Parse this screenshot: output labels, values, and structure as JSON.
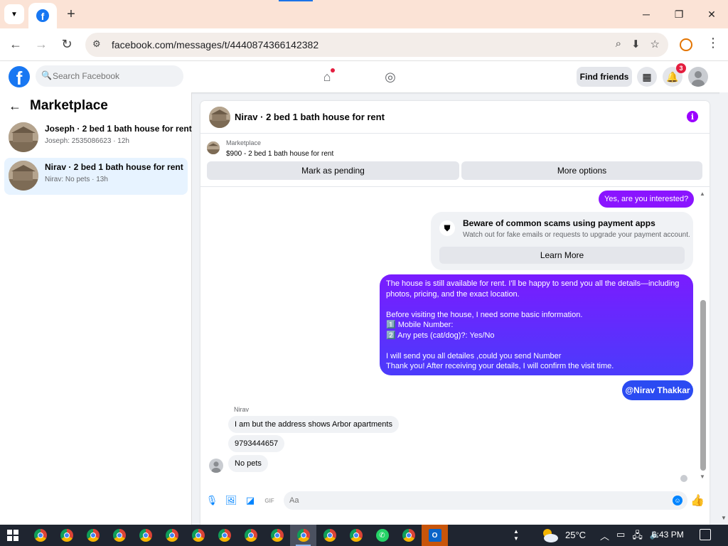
{
  "browser": {
    "url": "facebook.com/messages/t/4440874366142382"
  },
  "fb_header": {
    "search_placeholder": "Search Facebook",
    "find_friends_label": "Find friends",
    "notification_count": "3"
  },
  "sidebar": {
    "title": "Marketplace",
    "conversations": [
      {
        "title": "Joseph · 2 bed 1 bath house for rent",
        "snippet": "Joseph: 2535086623 · 12h",
        "active": false
      },
      {
        "title": "Nirav · 2 bed 1 bath house for rent",
        "snippet": "Nirav: No pets · 13h",
        "active": true
      }
    ]
  },
  "chat": {
    "title": "Nirav · 2 bed 1 bath house for rent",
    "listing": {
      "source": "Marketplace",
      "title": "$900 - 2 bed 1 bath house for rent",
      "mark_pending_label": "Mark as pending",
      "more_options_label": "More options"
    },
    "messages": {
      "outgoing_interested": "Yes, are you interested?",
      "scam_title": "Beware of common scams using payment apps",
      "scam_subtitle": "Watch out for fake emails or requests to upgrade your payment account.",
      "learn_more_label": "Learn More",
      "long_message": "The house is still available for rent. I'll be happy to send you all the details—including photos, pricing, and the exact location.\n\nBefore visiting the house, I need some basic information.\n1️⃣  Mobile Number:\n2️⃣ Any pets (cat/dog)?: Yes/No\n\nI will send you all detailes ,could you send Number\nThank you! After receiving your details, I will confirm the visit time.",
      "mention": "@Nirav Thakkar",
      "sender_name": "Nirav",
      "incoming": [
        "I am but the address shows Arbor apartments",
        "9793444657",
        "No pets"
      ]
    },
    "composer_placeholder": "Aa"
  },
  "taskbar": {
    "temperature": "25°C",
    "time": "6:43 PM"
  },
  "colors": {
    "facebook_blue": "#1877f2",
    "messenger_purple": "#8a14ff",
    "mention_blue": "#2b4bf2"
  }
}
